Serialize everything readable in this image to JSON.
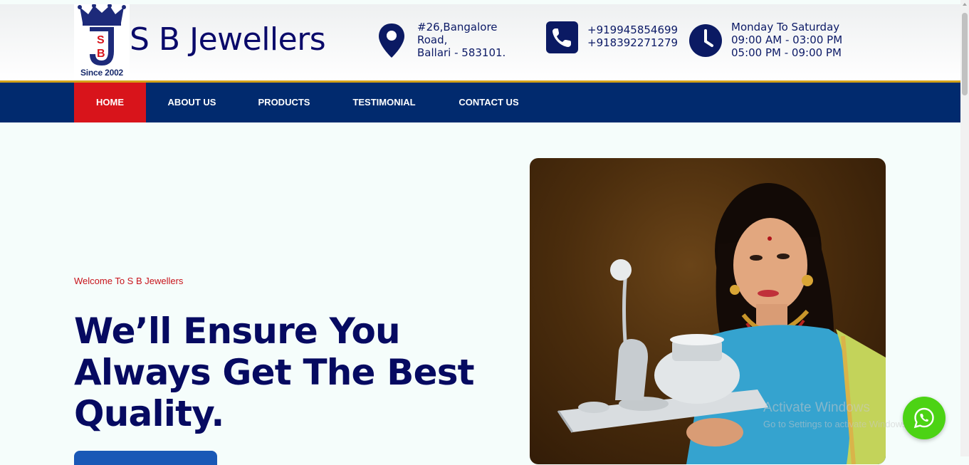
{
  "header": {
    "logo_since": "Since 2002",
    "brand_name": "S B Jewellers",
    "address": {
      "icon": "location-pin-icon",
      "lines": [
        "#26,Bangalore",
        "Road,",
        "Ballari - 583101."
      ]
    },
    "phone": {
      "icon": "phone-icon",
      "lines": [
        "+919945854699",
        "+918392271279"
      ]
    },
    "hours": {
      "icon": "clock-icon",
      "lines": [
        "Monday To Saturday",
        "09:00 AM - 03:00 PM",
        "05:00 PM - 09:00 PM"
      ]
    }
  },
  "nav": {
    "items": [
      {
        "label": "HOME",
        "active": true
      },
      {
        "label": "ABOUT US",
        "active": false
      },
      {
        "label": "PRODUCTS",
        "active": false
      },
      {
        "label": "TESTIMONIAL",
        "active": false
      },
      {
        "label": "CONTACT US",
        "active": false
      }
    ]
  },
  "hero": {
    "kicker": "Welcome To S B Jewellers",
    "title": "We’ll Ensure You Always Get The Best Quality."
  },
  "watermark": {
    "line1": "Activate Windows",
    "line2": "Go to Settings to activate Windows."
  },
  "whatsapp": {
    "icon": "whatsapp-icon"
  },
  "colors": {
    "navy": "#012a6e",
    "brand_text": "#0a0a6a",
    "accent_red": "#d8141b",
    "gold": "#d4a21a",
    "whatsapp_green": "#4cd314"
  }
}
